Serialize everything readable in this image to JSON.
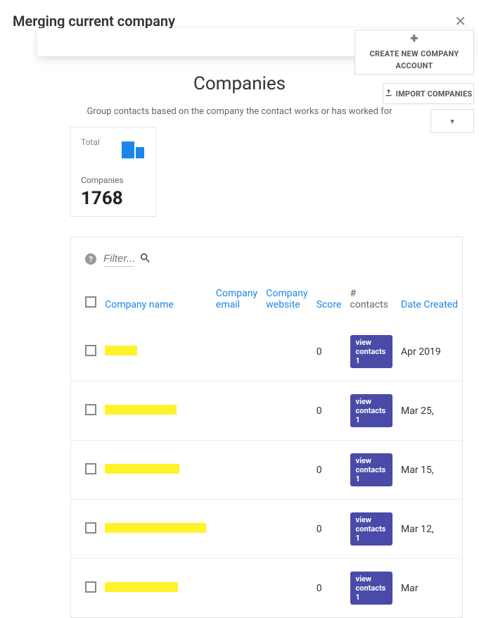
{
  "modal": {
    "title": "Merging current company"
  },
  "actions": {
    "create_label": "CREATE NEW COMPANY ACCOUNT",
    "import_label": "IMPORT COMPANIES"
  },
  "page": {
    "heading": "Companies",
    "subtitle": "Group contacts based on the company the contact works or has worked for"
  },
  "stats": {
    "total_label": "Total",
    "companies_label": "Companies",
    "count": "1768"
  },
  "filter": {
    "placeholder": "Filter..."
  },
  "columns": {
    "name": "Company name",
    "email": "Company email",
    "website": "Company website",
    "score": "Score",
    "contacts": "# contacts",
    "created": "Date Created"
  },
  "pill_prefix": "view contacts",
  "rows": [
    {
      "name_w": 46,
      "score": "0",
      "contacts": "1",
      "date": "Apr 2019"
    },
    {
      "name_w": 102,
      "score": "0",
      "contacts": "1",
      "date": "Mar 25,"
    },
    {
      "name_w": 106,
      "score": "0",
      "contacts": "1",
      "date": "Mar 15,"
    },
    {
      "name_w": 144,
      "score": "0",
      "contacts": "1",
      "date": "Mar 12,"
    },
    {
      "name_w": 104,
      "score": "0",
      "contacts": "1",
      "date": "Mar"
    }
  ]
}
